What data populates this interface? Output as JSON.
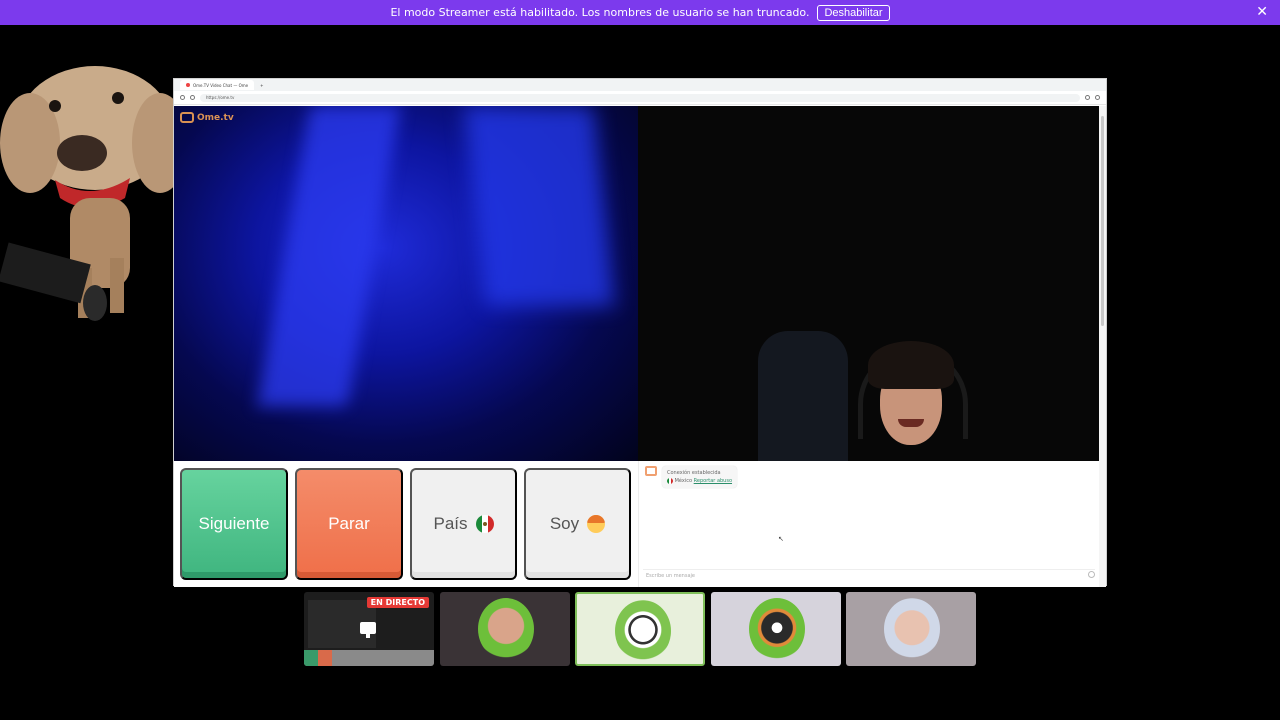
{
  "banner": {
    "message": "El modo Streamer está habilitado. Los nombres de usuario se han truncado.",
    "button_label": "Deshabilitar",
    "close_symbol": "✕",
    "color": "#7c3aed"
  },
  "browser": {
    "tab_title": "Ome.TV Video Chat — Ome",
    "url": "https://ome.tv"
  },
  "site": {
    "logo_text": "Ome.tv"
  },
  "controls": {
    "next_label": "Siguiente",
    "stop_label": "Parar",
    "country_label": "País",
    "gender_label": "Soy",
    "next_color": "#4cc48a",
    "stop_color": "#f07a52"
  },
  "chat": {
    "status_text": "Conexión establecida",
    "country_name": "México",
    "report_link": "Reportar abuso",
    "input_placeholder": "Escribe un mensaje"
  },
  "webcams": {
    "live_badge": "EN DIRECTO"
  }
}
